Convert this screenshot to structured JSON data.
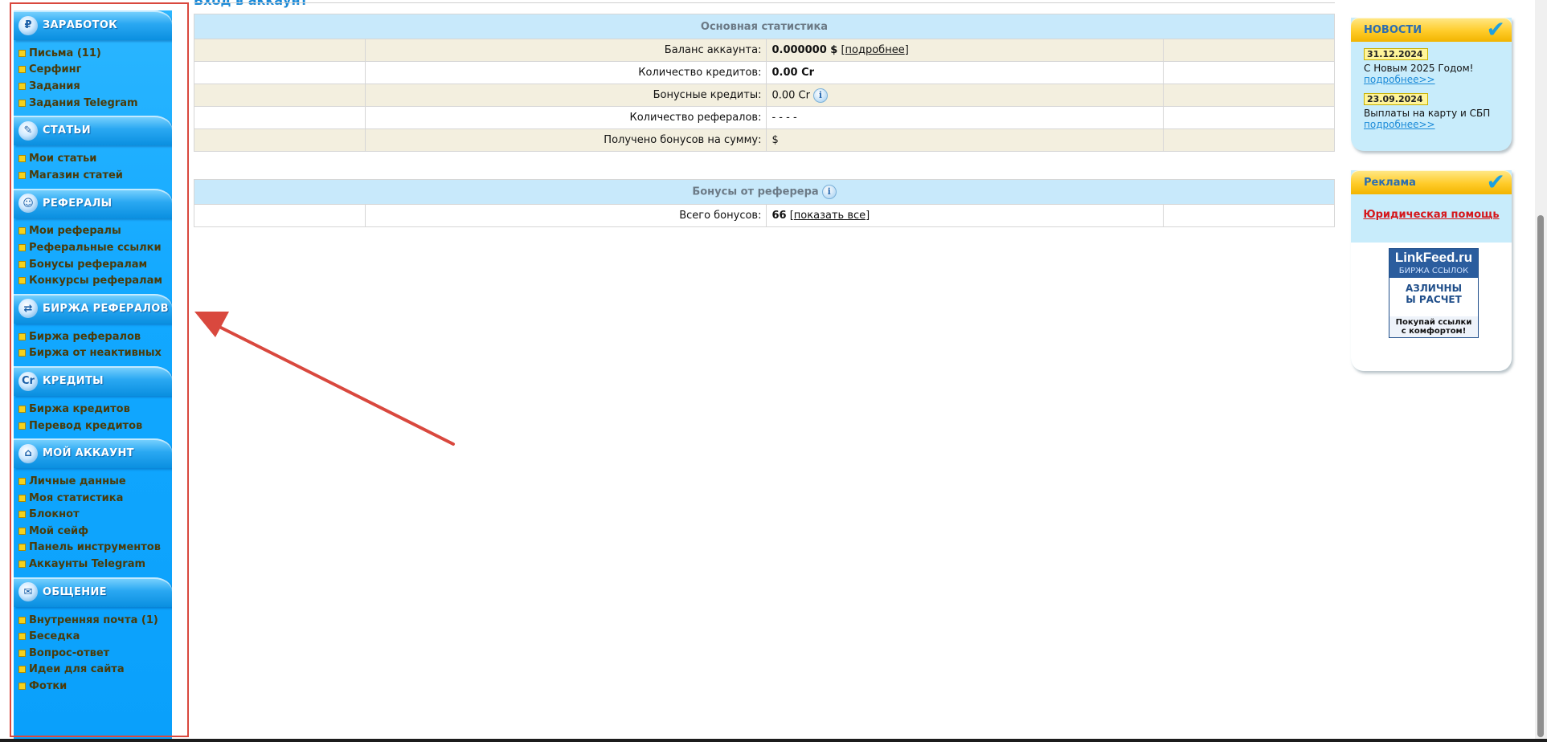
{
  "page_title_fragment": "Вход в аккаунт",
  "sidebar": {
    "sections": [
      {
        "title": "ЗАРАБОТОК",
        "icon": "money-icon",
        "items": [
          "Письма (11)",
          "Серфинг",
          "Задания",
          "Задания Telegram"
        ]
      },
      {
        "title": "СТАТЬИ",
        "icon": "article-icon",
        "items": [
          "Мои статьи",
          "Магазин статей"
        ]
      },
      {
        "title": "РЕФЕРАЛЫ",
        "icon": "referrals-icon",
        "items": [
          "Мои рефералы",
          "Реферальные ссылки",
          "Бонусы рефералам",
          "Конкурсы рефералам"
        ]
      },
      {
        "title": "БИРЖА РЕФЕРАЛОВ",
        "icon": "exchange-icon",
        "items": [
          "Биржа рефералов",
          "Биржа от неактивных"
        ]
      },
      {
        "title": "КРЕДИТЫ",
        "icon": "credits-icon",
        "items": [
          "Биржа кредитов",
          "Перевод кредитов"
        ]
      },
      {
        "title": "МОЙ АККАУНТ",
        "icon": "account-icon",
        "items": [
          "Личные данные",
          "Моя статистика",
          "Блокнот",
          "Мой сейф",
          "Панель инструментов",
          "Аккаунты Telegram"
        ]
      },
      {
        "title": "ОБЩЕНИЕ",
        "icon": "chat-icon",
        "items": [
          "Внутренняя почта (1)",
          "Беседка",
          "Вопрос-ответ",
          "Идеи для сайта",
          "Фотки"
        ]
      }
    ]
  },
  "stats": {
    "header": "Основная статистика",
    "rows": [
      {
        "label": "Баланс аккаунта:",
        "value": "0.000000 $",
        "link": "подробнее"
      },
      {
        "label": "Количество кредитов:",
        "value": "0.00 Cr"
      },
      {
        "label": "Бонусные кредиты:",
        "value": "0.00 Cr"
      },
      {
        "label": "Количество рефералов:",
        "value": "- - - -"
      },
      {
        "label": "Получено бонусов на сумму:",
        "value": "$"
      }
    ]
  },
  "referrer": {
    "header": "Бонусы от реферера",
    "label": "Всего бонусов:",
    "value": "66",
    "link": "показать все"
  },
  "news": {
    "title": "НОВОСТИ",
    "items": [
      {
        "date": "31.12.2024",
        "text": "С Новым 2025 Годом!",
        "more": "подробнее>>"
      },
      {
        "date": "23.09.2024",
        "text": "Выплаты на карту и СБП",
        "more": "подробнее>>"
      }
    ]
  },
  "ads": {
    "title": "Реклама",
    "link": "Юридическая помощь",
    "banner": {
      "name": "LinkFeed.ru",
      "sub": "БИРЖА ССЫЛОК",
      "line1": "АЗЛИЧНЫ",
      "line2": "Ы РАСЧЕТ",
      "bottom1": "Покупай ссылки",
      "bottom2": "с комфортом!"
    }
  },
  "colors": {
    "accent_red": "#d9483e",
    "sidebar_blue": "#12a8ff",
    "news_yellow": "#ffcc2a"
  }
}
